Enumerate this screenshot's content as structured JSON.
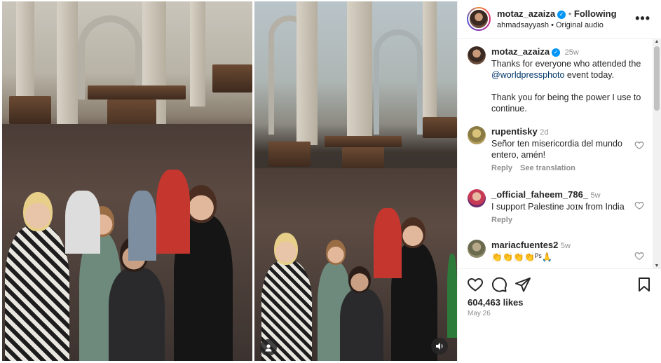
{
  "post": {
    "author": "motaz_azaiza",
    "follow_state": "Following",
    "separator": "•",
    "audio_owner": "ahmadsayyash",
    "audio_label": "Original audio",
    "more_icon": "more-horizontal-icon"
  },
  "caption": {
    "username": "motaz_azaiza",
    "age": "25w",
    "line1": "Thanks for everyone who attended the",
    "mention": "@worldpressphoto",
    "line2_rest": " event today.",
    "para2": "Thank you for being the power I use to continue."
  },
  "comments": [
    {
      "username": "rupentisky",
      "age": "2d",
      "text": "Señor ten misericordia del mundo entero, amén!",
      "reply": "Reply",
      "translate": "See translation"
    },
    {
      "username": "_official_faheem_786_",
      "age": "5w",
      "text": "I support Palestine ᴊᴏɪɴ from India",
      "reply": "Reply"
    },
    {
      "username": "mariacfuentes2",
      "age": "5w",
      "text": "👏👏👏👏ᴾˢ🙏"
    }
  ],
  "actions": {
    "likes": "604,463 likes",
    "date": "May 26"
  },
  "colors": {
    "link": "#00376b",
    "verified": "#0095f6",
    "muted": "#8e8e8e"
  }
}
